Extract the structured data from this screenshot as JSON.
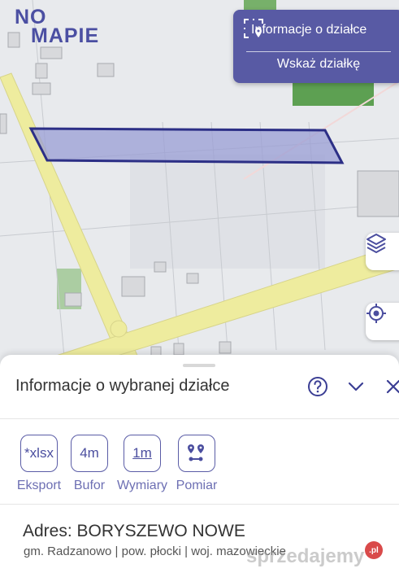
{
  "brand": {
    "line1": "NO",
    "line2": "MAPIE"
  },
  "info_panel": {
    "icon": "parcel-select-icon",
    "title": "Informacje o działce",
    "action": "Wskaż działkę"
  },
  "map_controls": {
    "layers_icon": "layers-icon",
    "locate_icon": "locate-crosshair-icon"
  },
  "sheet": {
    "title": "Informacje o wybranej działce",
    "help_icon": "help-icon",
    "collapse_icon": "chevron-down-icon",
    "close_icon": "close-icon",
    "tools": [
      {
        "icon_text": "*xlsx",
        "label": "Eksport"
      },
      {
        "icon_text": "4m",
        "label": "Bufor"
      },
      {
        "icon_text": "1m",
        "label": "Wymiary"
      },
      {
        "icon_text": "",
        "label": "Pomiar"
      }
    ],
    "address": "Adres: BORYSZEWO NOWE",
    "admin": "gm. Radzanowo | pow. płocki | woj. mazowieckie"
  },
  "watermark": {
    "text": "sprzedajemy",
    "badge": ".pl"
  },
  "colors": {
    "accent": "#585aa4",
    "parcel_fill": "#9a9ed4",
    "parcel_stroke": "#2c2f86",
    "road": "#ecea9c",
    "green_area": "#4f9a48"
  }
}
